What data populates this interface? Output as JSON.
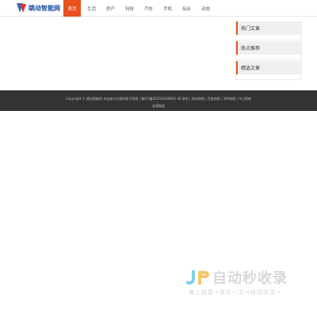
{
  "site": {
    "logo_text": "跳动智能网"
  },
  "nav": {
    "items": [
      {
        "label": "首页",
        "active": true
      },
      {
        "label": "生活",
        "active": false
      },
      {
        "label": "房产",
        "active": false
      },
      {
        "label": "科技",
        "active": false
      },
      {
        "label": "汽车",
        "active": false
      },
      {
        "label": "手机",
        "active": false
      },
      {
        "label": "综合",
        "active": false
      },
      {
        "label": "动态",
        "active": false
      }
    ]
  },
  "sidebar": {
    "boxes": [
      {
        "title": "热门文章"
      },
      {
        "title": "热点推荐"
      },
      {
        "title": "精选文章"
      }
    ]
  },
  "footer": {
    "line1": "Copyright © 跳动智能网 本站部分内容转载于网络 | 鲁ICP备2025030088号-46  联系 | 网站地图 | 百度地图 | 360地图 | 今日更新",
    "line2": "友情链接"
  },
  "watermark": {
    "title": "自动秒收录",
    "subtitle": "做上链接→来访一次→自动收录→"
  },
  "colors": {
    "accent": "#e8501e",
    "footer_bg": "#333333",
    "logo_blue": "#1b4fa0"
  }
}
